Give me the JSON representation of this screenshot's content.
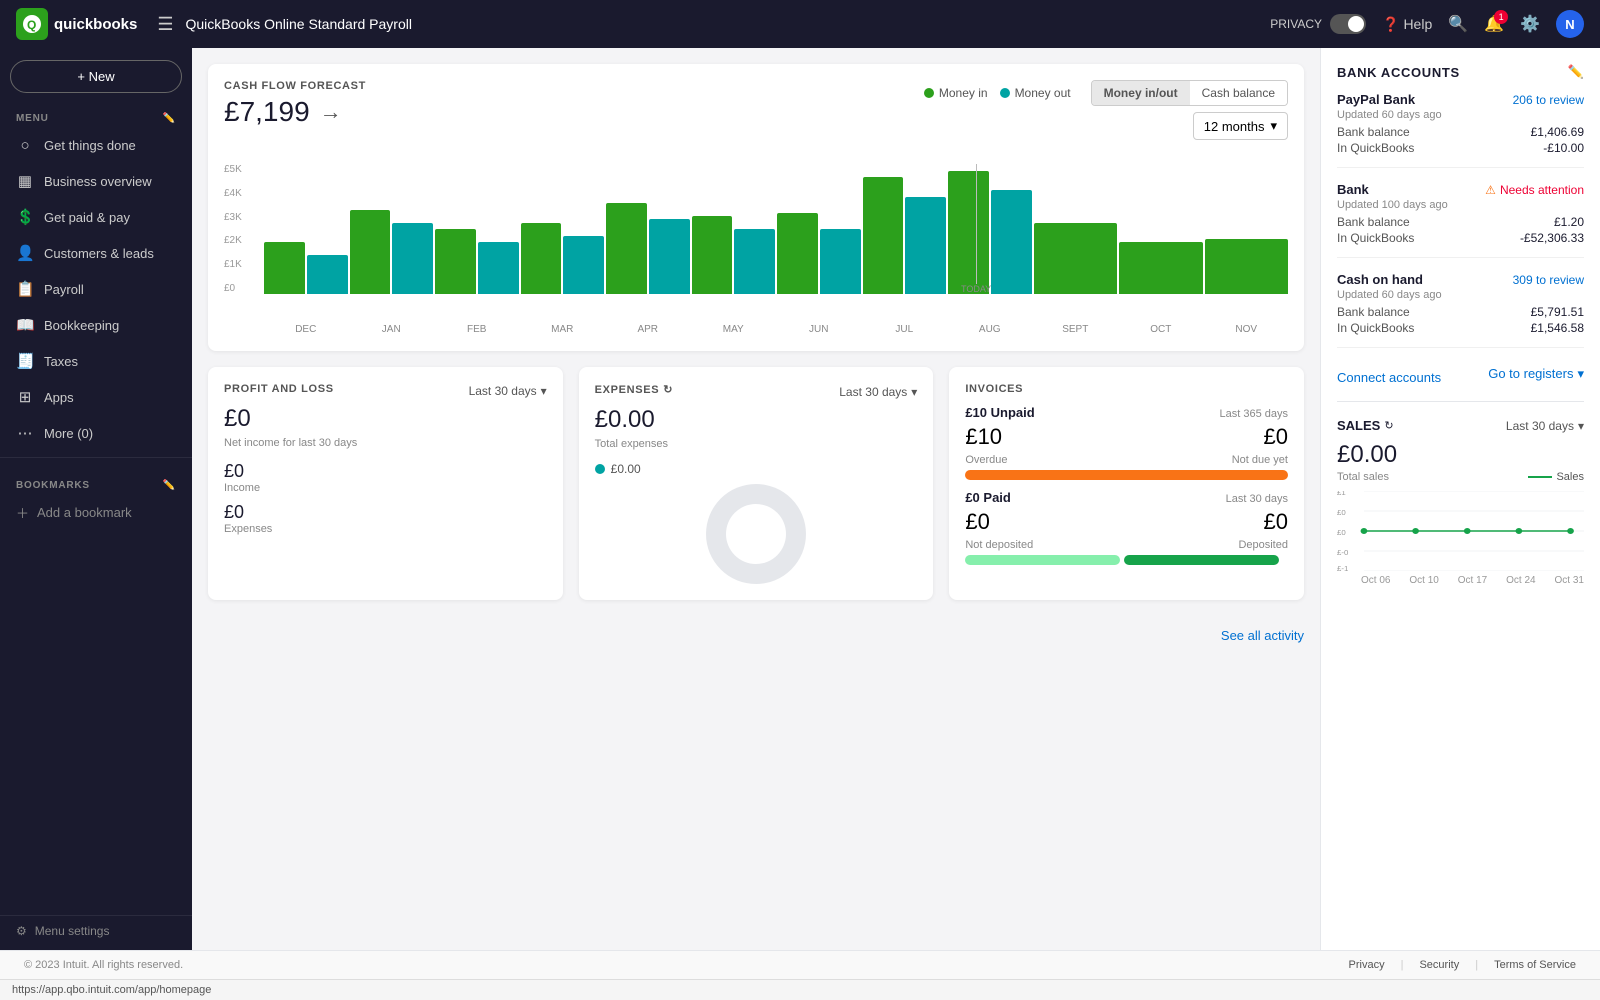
{
  "topbar": {
    "logo_text": "quickbooks",
    "title": "QuickBooks Online Standard Payroll",
    "help_label": "Help",
    "privacy_label": "PRIVACY",
    "avatar_initials": "N"
  },
  "sidebar": {
    "new_button": "+ New",
    "menu_label": "MENU",
    "items": [
      {
        "id": "get-things-done",
        "label": "Get things done",
        "icon": "⊙"
      },
      {
        "id": "business-overview",
        "label": "Business overview",
        "icon": "📊"
      },
      {
        "id": "get-paid-pay",
        "label": "Get paid & pay",
        "icon": "💰"
      },
      {
        "id": "customers-leads",
        "label": "Customers & leads",
        "icon": "👥"
      },
      {
        "id": "payroll",
        "label": "Payroll",
        "icon": "📋"
      },
      {
        "id": "bookkeeping",
        "label": "Bookkeeping",
        "icon": "📖"
      },
      {
        "id": "taxes",
        "label": "Taxes",
        "icon": "🧾"
      },
      {
        "id": "apps",
        "label": "Apps",
        "icon": "⊞"
      },
      {
        "id": "more",
        "label": "More (0)",
        "icon": "⋯"
      }
    ],
    "bookmarks_label": "BOOKMARKS",
    "add_bookmark": "Add a bookmark",
    "menu_settings": "Menu settings"
  },
  "cashflow": {
    "title": "CASH FLOW FORECAST",
    "amount": "£7,199",
    "legend_money_in": "Money in",
    "legend_money_out": "Money out",
    "btn_money_in_out": "Money in/out",
    "btn_cash_balance": "Cash balance",
    "period": "12 months",
    "today_label": "TODAY",
    "y_axis": [
      "£5K",
      "£4K",
      "£3K",
      "£2K",
      "£1K",
      "£0"
    ],
    "months": [
      "DEC",
      "JAN",
      "FEB",
      "MAR",
      "APR",
      "MAY",
      "JUN",
      "JUL",
      "AUG",
      "SEPT",
      "OCT",
      "NOV"
    ],
    "bars": [
      {
        "green": 40,
        "teal": 30
      },
      {
        "green": 65,
        "teal": 55
      },
      {
        "green": 50,
        "teal": 40
      },
      {
        "green": 55,
        "teal": 45
      },
      {
        "green": 70,
        "teal": 58
      },
      {
        "green": 60,
        "teal": 50
      },
      {
        "green": 62,
        "teal": 50
      },
      {
        "green": 90,
        "teal": 75
      },
      {
        "green": 95,
        "teal": 80
      },
      {
        "green": 55,
        "teal": 0
      },
      {
        "green": 40,
        "teal": 0
      },
      {
        "green": 42,
        "teal": 0
      }
    ]
  },
  "profit_loss": {
    "title": "PROFIT AND LOSS",
    "period": "Last 30 days",
    "net_income_amount": "£0",
    "net_income_label": "Net income for last 30 days",
    "income_amount": "£0",
    "income_label": "Income",
    "expenses_amount": "£0",
    "expenses_label": "Expenses"
  },
  "expenses": {
    "title": "EXPENSES",
    "period": "Last 30 days",
    "total_amount": "£0.00",
    "total_label": "Total expenses",
    "item_amount": "£0.00"
  },
  "invoices": {
    "title": "INVOICES",
    "unpaid_label": "£10 Unpaid",
    "unpaid_period": "Last 365 days",
    "overdue_amount": "£10",
    "not_due_yet_amount": "£0",
    "overdue_label": "Overdue",
    "not_due_label": "Not due yet",
    "paid_label": "£0 Paid",
    "paid_period": "Last 30 days",
    "not_deposited_amount": "£0",
    "deposited_amount": "£0",
    "not_deposited_label": "Not deposited",
    "deposited_label": "Deposited"
  },
  "bank_accounts": {
    "title": "BANK ACCOUNTS",
    "accounts": [
      {
        "name": "PayPal Bank",
        "review_count": "206 to review",
        "updated": "Updated 60 days ago",
        "bank_balance_label": "Bank balance",
        "bank_balance": "£1,406.69",
        "in_qb_label": "In QuickBooks",
        "in_qb": "-£10.00"
      },
      {
        "name": "Bank",
        "needs_attention": "Needs attention",
        "updated": "Updated 100 days ago",
        "bank_balance_label": "Bank balance",
        "bank_balance": "£1.20",
        "in_qb_label": "In QuickBooks",
        "in_qb": "-£52,306.33"
      },
      {
        "name": "Cash on hand",
        "review_count": "309 to review",
        "updated": "Updated 60 days ago",
        "bank_balance_label": "Bank balance",
        "bank_balance": "£5,791.51",
        "in_qb_label": "In QuickBooks",
        "in_qb": "£1,546.58"
      }
    ],
    "connect_label": "Connect accounts",
    "go_registers_label": "Go to registers"
  },
  "sales": {
    "title": "SALES",
    "period": "Last 30 days",
    "total_amount": "£0.00",
    "total_label": "Total sales",
    "legend_label": "Sales",
    "x_labels": [
      "Oct 06",
      "Oct 10",
      "Oct 17",
      "Oct 24",
      "Oct 31"
    ],
    "y_labels": [
      "£1",
      "£0",
      "£0",
      "£0",
      "£-0",
      "£-1"
    ]
  },
  "footer": {
    "copyright": "© 2023 Intuit. All rights reserved.",
    "links": [
      "Privacy",
      "Security",
      "Terms of Service"
    ]
  },
  "url_bar": "https://app.qbo.intuit.com/app/homepage",
  "see_all_label": "See all activity"
}
